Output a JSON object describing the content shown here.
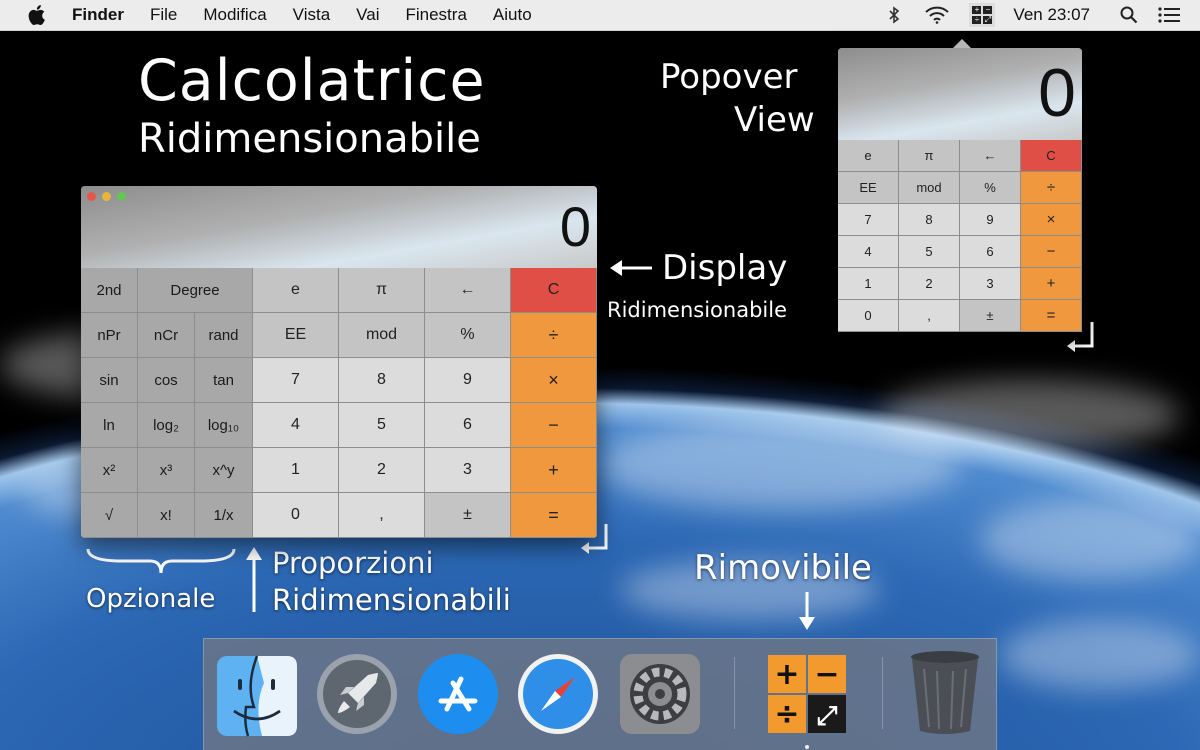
{
  "menubar": {
    "app_name": "Finder",
    "items": [
      "File",
      "Modifica",
      "Vista",
      "Vai",
      "Finestra",
      "Aiuto"
    ],
    "clock": "Ven 23:07",
    "status_calc_glyphs": [
      "+",
      "−",
      "÷",
      "⤢"
    ]
  },
  "annotations": {
    "title_line1": "Calcolatrice",
    "title_line2": "Ridimensionabile",
    "popover_line1": "Popover",
    "popover_line2": "View",
    "display_label": "Display",
    "display_sub": "Ridimensionabile",
    "optional": "Opzionale",
    "proportions_line1": "Proporzioni",
    "proportions_line2": "Ridimensionabili",
    "removable": "Rimovibile"
  },
  "calculator": {
    "display_value": "0",
    "keys": {
      "second": "2nd",
      "degree": "Degree",
      "e": "e",
      "pi": "π",
      "back": "←",
      "clear": "C",
      "npr": "nPr",
      "ncr": "nCr",
      "rand": "rand",
      "ee": "EE",
      "mod": "mod",
      "percent": "%",
      "divide": "÷",
      "sin": "sin",
      "cos": "cos",
      "tan": "tan",
      "seven": "7",
      "eight": "8",
      "nine": "9",
      "multiply": "×",
      "ln": "ln",
      "log2": "log₂",
      "log10": "log₁₀",
      "four": "4",
      "five": "5",
      "six": "6",
      "minus": "−",
      "square": "x²",
      "cube": "x³",
      "power": "x^y",
      "one": "1",
      "two": "2",
      "three": "3",
      "plus": "+",
      "sqrt": "√",
      "factorial": "x!",
      "reciprocal": "1/x",
      "zero": "0",
      "decimal": ",",
      "sign": "±",
      "equals": "="
    }
  },
  "popover": {
    "display_value": "0",
    "keys": {
      "e": "e",
      "pi": "π",
      "back": "←",
      "clear": "C",
      "ee": "EE",
      "mod": "mod",
      "percent": "%",
      "divide": "÷",
      "seven": "7",
      "eight": "8",
      "nine": "9",
      "multiply": "×",
      "four": "4",
      "five": "5",
      "six": "6",
      "minus": "−",
      "one": "1",
      "two": "2",
      "three": "3",
      "plus": "+",
      "zero": "0",
      "decimal": ",",
      "sign": "±",
      "equals": "="
    }
  },
  "dock": {
    "apps": [
      "finder",
      "launchpad",
      "app-store",
      "safari",
      "system-preferences",
      "calculator",
      "trash"
    ],
    "calculator_icon_glyphs": [
      "+",
      "−",
      "÷",
      "⤢"
    ]
  },
  "colors": {
    "operator": "#f0983e",
    "clear": "#e04f45",
    "digit_key": "#dcdcdc",
    "function_key": "#c4c4c4",
    "scientific_key": "#a8a8a8"
  }
}
